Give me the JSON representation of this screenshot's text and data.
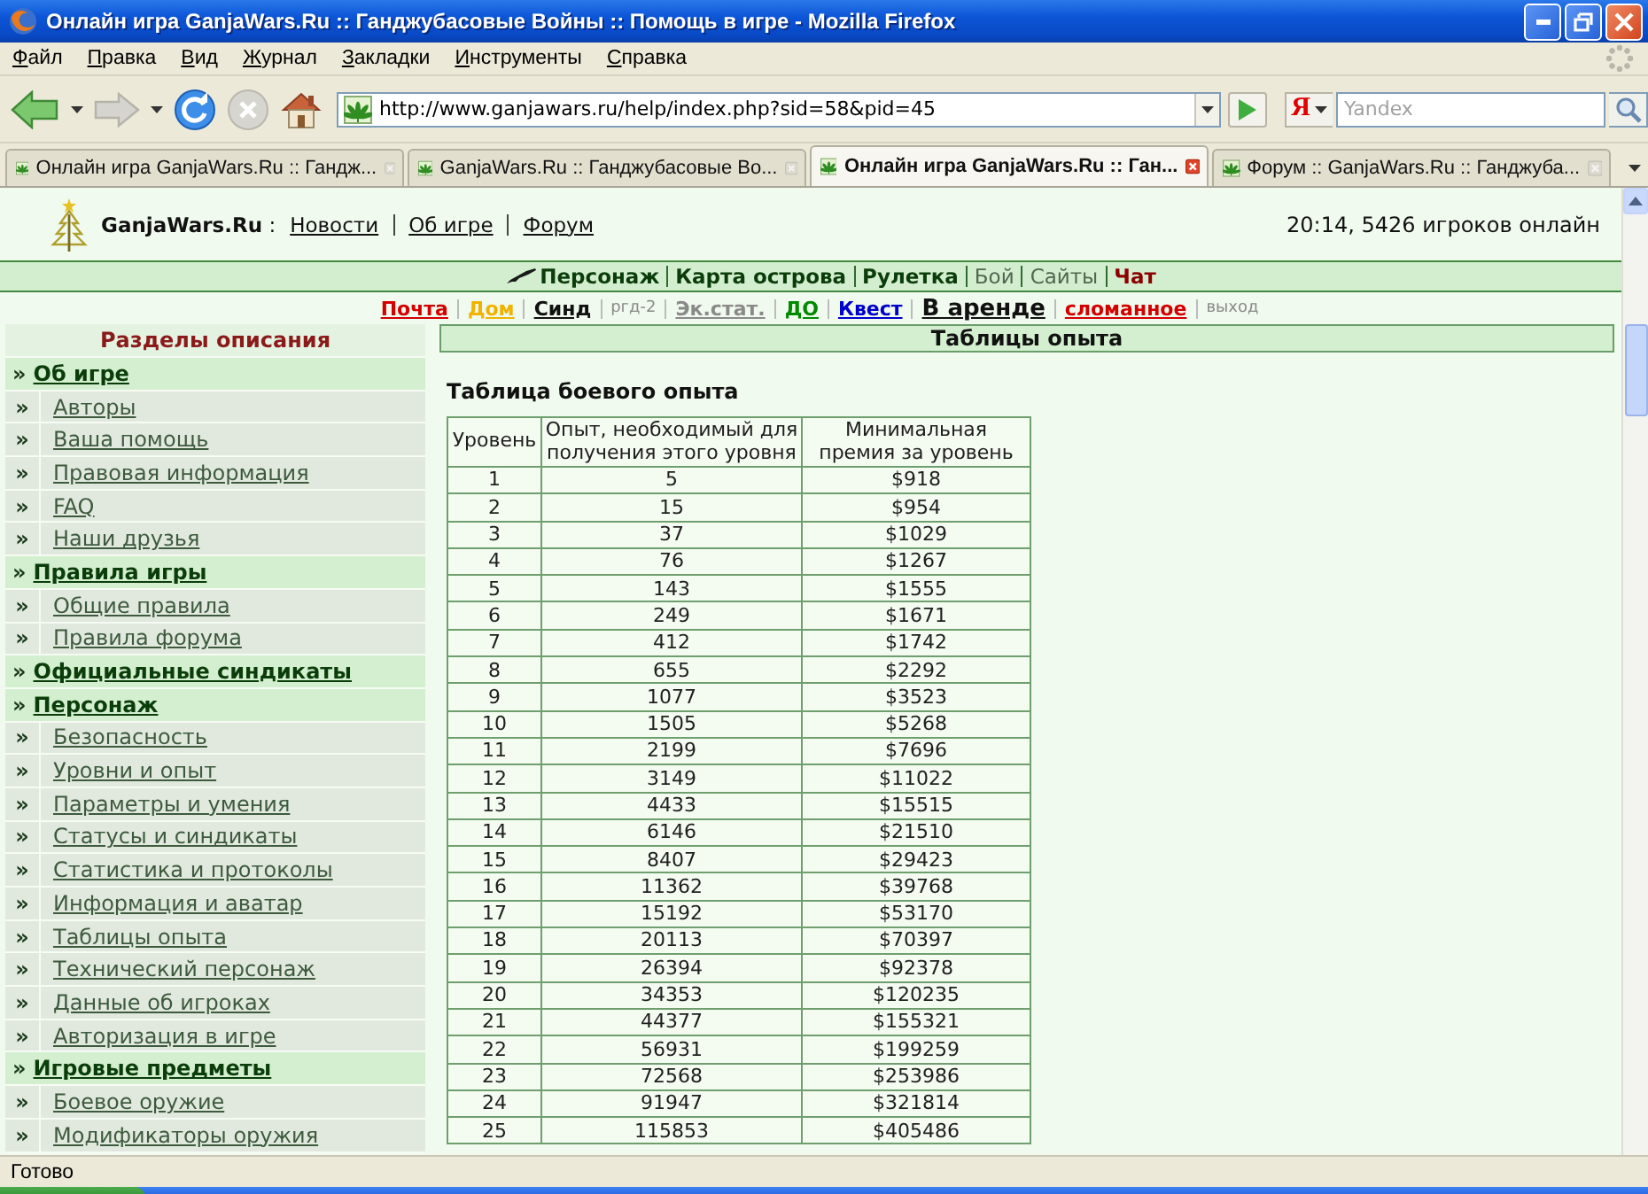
{
  "window": {
    "title": "Онлайн игра GanjaWars.Ru :: Ганджубасовые Войны :: Помощь в игре - Mozilla Firefox"
  },
  "menu_bar": [
    "Файл",
    "Правка",
    "Вид",
    "Журнал",
    "Закладки",
    "Инструменты",
    "Справка"
  ],
  "toolbar": {
    "address": "http://www.ganjawars.ru/help/index.php?sid=58&pid=45",
    "search_engine": "Я",
    "search_placeholder": "Yandex"
  },
  "tabs": [
    {
      "label": "Онлайн игра GanjaWars.Ru :: Гандж...",
      "selected": false
    },
    {
      "label": "GanjaWars.Ru :: Ганджубасовые Во...",
      "selected": false
    },
    {
      "label": "Онлайн игра GanjaWars.Ru :: Ган...",
      "selected": true
    },
    {
      "label": "Форум :: GanjaWars.Ru :: Ганджуба...",
      "selected": false
    }
  ],
  "site_header": {
    "site_name": "**GanjaWars.Ru** :",
    "links": [
      "Новости",
      "Об игре",
      "Форум"
    ],
    "online": "20:14, 5426 игроков онлайн"
  },
  "main_nav": [
    {
      "label": "Персонаж",
      "kind": "bold",
      "color": "#0b3d0b"
    },
    {
      "label": "Карта острова",
      "kind": "bold",
      "color": "#0b3d0b"
    },
    {
      "label": "Рулетка",
      "kind": "bold",
      "color": "#0b3d0b"
    },
    {
      "label": "Бой",
      "kind": "plain",
      "color": "#4f664f"
    },
    {
      "label": "Сайты",
      "kind": "plain",
      "color": "#4f664f"
    },
    {
      "label": "Чат",
      "kind": "bold",
      "color": "#8b0000"
    }
  ],
  "sub_nav": [
    {
      "label": "Почта",
      "kind": "link",
      "color": "#d40000"
    },
    {
      "label": "Дом",
      "kind": "link",
      "color": "#f0b400"
    },
    {
      "label": "Синд",
      "kind": "link",
      "color": "#111111"
    },
    {
      "label": "ргд-2",
      "kind": "small",
      "color": "#8a8a8a"
    },
    {
      "label": "Эк.стат.",
      "kind": "link",
      "color": "#8a8a8a"
    },
    {
      "label": "ДО",
      "kind": "link",
      "color": "#008a00"
    },
    {
      "label": "Квест",
      "kind": "link",
      "color": "#0000cc"
    },
    {
      "label": "В аренде",
      "kind": "large",
      "color": "#111111"
    },
    {
      "label": "сломанное",
      "kind": "link",
      "color": "#d40000"
    },
    {
      "label": "выход",
      "kind": "small",
      "color": "#8a8a8a"
    }
  ],
  "sidebar": {
    "title": "Разделы описания",
    "sections": [
      {
        "marker": "»",
        "label": "Об игре",
        "children": [
          {
            "marker": "»",
            "label": "Авторы"
          },
          {
            "marker": "»",
            "label": "Ваша помощь"
          },
          {
            "marker": "»",
            "label": "Правовая информация"
          },
          {
            "marker": "»",
            "label": "FAQ"
          },
          {
            "marker": "»",
            "label": "Наши друзья"
          }
        ]
      },
      {
        "marker": "»",
        "label": "Правила игры",
        "children": [
          {
            "marker": "»",
            "label": "Общие правила"
          },
          {
            "marker": "»",
            "label": "Правила форума"
          }
        ]
      },
      {
        "marker": "»",
        "label": "Официальные синдикаты"
      },
      {
        "marker": "»",
        "label": "Персонаж",
        "children": [
          {
            "marker": "»",
            "label": "Безопасность"
          },
          {
            "marker": "»",
            "label": "Уровни и опыт"
          },
          {
            "marker": "»",
            "label": "Параметры и умения"
          },
          {
            "marker": "»",
            "label": "Статусы и синдикаты"
          },
          {
            "marker": "»",
            "label": "Статистика и протоколы"
          },
          {
            "marker": "»",
            "label": "Информация и аватар"
          },
          {
            "marker": "»",
            "label": "Таблицы опыта"
          },
          {
            "marker": "»",
            "label": "Технический персонаж"
          },
          {
            "marker": "»",
            "label": "Данные об игроках"
          },
          {
            "marker": "»",
            "label": "Авторизация в игре"
          }
        ]
      },
      {
        "marker": "»",
        "label": "Игровые предметы",
        "children": [
          {
            "marker": "»",
            "label": "Боевое оружие"
          },
          {
            "marker": "»",
            "label": "Модификаторы оружия"
          }
        ]
      }
    ]
  },
  "content": {
    "heading": "Таблицы опыта",
    "subheading": "Таблица боевого опыта",
    "table": {
      "columns": [
        "Уровень",
        "Опыт, необходимый для получения этого уровня",
        "Минимальная премия за уровень"
      ],
      "rows": [
        [
          "1",
          "5",
          "$918"
        ],
        [
          "2",
          "15",
          "$954"
        ],
        [
          "3",
          "37",
          "$1029"
        ],
        [
          "4",
          "76",
          "$1267"
        ],
        [
          "5",
          "143",
          "$1555"
        ],
        [
          "6",
          "249",
          "$1671"
        ],
        [
          "7",
          "412",
          "$1742"
        ],
        [
          "8",
          "655",
          "$2292"
        ],
        [
          "9",
          "1077",
          "$3523"
        ],
        [
          "10",
          "1505",
          "$5268"
        ],
        [
          "11",
          "2199",
          "$7696"
        ],
        [
          "12",
          "3149",
          "$11022"
        ],
        [
          "13",
          "4433",
          "$15515"
        ],
        [
          "14",
          "6146",
          "$21510"
        ],
        [
          "15",
          "8407",
          "$29423"
        ],
        [
          "16",
          "11362",
          "$39768"
        ],
        [
          "17",
          "15192",
          "$53170"
        ],
        [
          "18",
          "20113",
          "$70397"
        ],
        [
          "19",
          "26394",
          "$92378"
        ],
        [
          "20",
          "34353",
          "$120235"
        ],
        [
          "21",
          "44377",
          "$155321"
        ],
        [
          "22",
          "56931",
          "$199259"
        ],
        [
          "23",
          "72568",
          "$253986"
        ],
        [
          "24",
          "91947",
          "$321814"
        ],
        [
          "25",
          "115853",
          "$405486"
        ]
      ]
    }
  },
  "status_bar": {
    "text": "Готово"
  }
}
